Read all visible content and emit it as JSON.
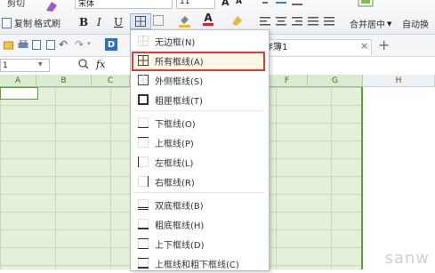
{
  "ribbon": {
    "cut_label": "剪切",
    "copy_label": "复制",
    "format_painter_label": "格式刷",
    "font_name": "宋体",
    "font_size": "11",
    "bold": "B",
    "italic": "I",
    "underline": "U",
    "font_color_letter": "A",
    "grow_font": "A",
    "shrink_font": "A",
    "merge_label": "合并居中",
    "wrap_label": "自动换",
    "border_accent": "#3a7bd5",
    "fill_color": "#f2c200",
    "font_color_bar": "#e02020"
  },
  "row2": {
    "letter": "D",
    "tab_label": "作簿1",
    "close": "×",
    "add": "+"
  },
  "formula_bar": {
    "name_box": "1",
    "zoom_icon": "zoom-icon",
    "fx": "fx"
  },
  "columns": [
    "A",
    "B",
    "C",
    "F",
    "G",
    "H"
  ],
  "menu": {
    "items": [
      {
        "label": "无边框(N)",
        "icon": "no-border"
      },
      {
        "label": "所有框线(A)",
        "icon": "all-borders"
      },
      {
        "label": "外侧框线(S)",
        "icon": "outside-borders"
      },
      {
        "label": "粗匣框线(T)",
        "icon": "thick-box-border"
      },
      {
        "label": "下框线(O)",
        "icon": "bottom-border"
      },
      {
        "label": "上框线(P)",
        "icon": "top-border"
      },
      {
        "label": "左框线(L)",
        "icon": "left-border"
      },
      {
        "label": "右框线(R)",
        "icon": "right-border"
      },
      {
        "label": "双底框线(B)",
        "icon": "double-bottom-border"
      },
      {
        "label": "粗底框线(H)",
        "icon": "thick-bottom-border"
      },
      {
        "label": "上下框线(D)",
        "icon": "top-bottom-border"
      },
      {
        "label": "上框线和粗下框线(C)",
        "icon": "top-thick-bottom-border"
      }
    ],
    "highlight_color": "#d93a3a"
  },
  "watermark": "sanw"
}
